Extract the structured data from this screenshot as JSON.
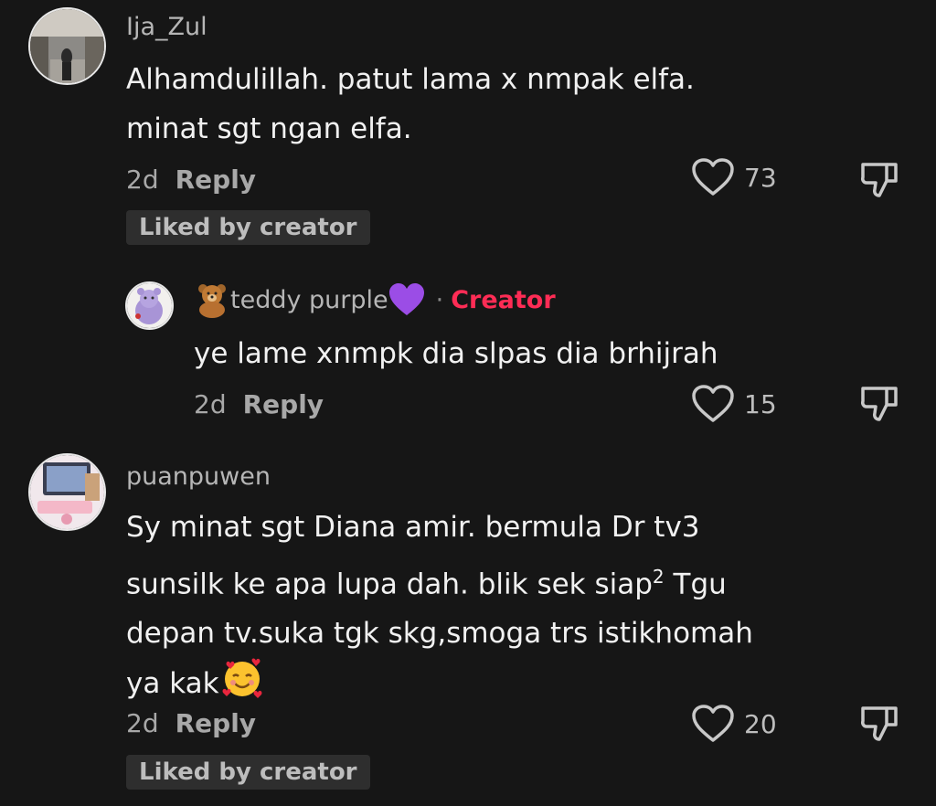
{
  "comments": [
    {
      "username": "Ija_Zul",
      "lines": [
        "Alhamdulillah. patut lama x nmpak elfa.",
        "minat sgt ngan elfa."
      ],
      "time": "2d",
      "reply_label": "Reply",
      "likes": "73",
      "badge": "Liked by creator"
    },
    {
      "username": "teddy purple",
      "creator_label": "Creator",
      "text": "ye lame xnmpk dia slpas dia brhijrah",
      "time": "2d",
      "reply_label": "Reply",
      "likes": "15"
    },
    {
      "username": "puanpuwen",
      "line1": "Sy minat sgt Diana amir. bermula Dr tv3",
      "line2a": "sunsilk ke apa lupa dah. blik sek siap",
      "line2_sup": "2",
      "line2b": " Tgu",
      "line3": "depan tv.suka tgk skg,smoga trs istikhomah",
      "line4": "ya kak",
      "time": "2d",
      "reply_label": "Reply",
      "likes": "20",
      "badge": "Liked by creator"
    }
  ],
  "icons": {
    "like": "heart-outline-icon",
    "dislike": "thumbs-down-outline-icon",
    "teddy": "teddy-bear-emoji",
    "purple_heart": "purple-heart-emoji",
    "smile_hearts": "smiling-face-with-hearts-emoji"
  },
  "colors": {
    "background": "#161616",
    "creator": "#fe2c55",
    "badge_bg": "#2e2e2e"
  }
}
